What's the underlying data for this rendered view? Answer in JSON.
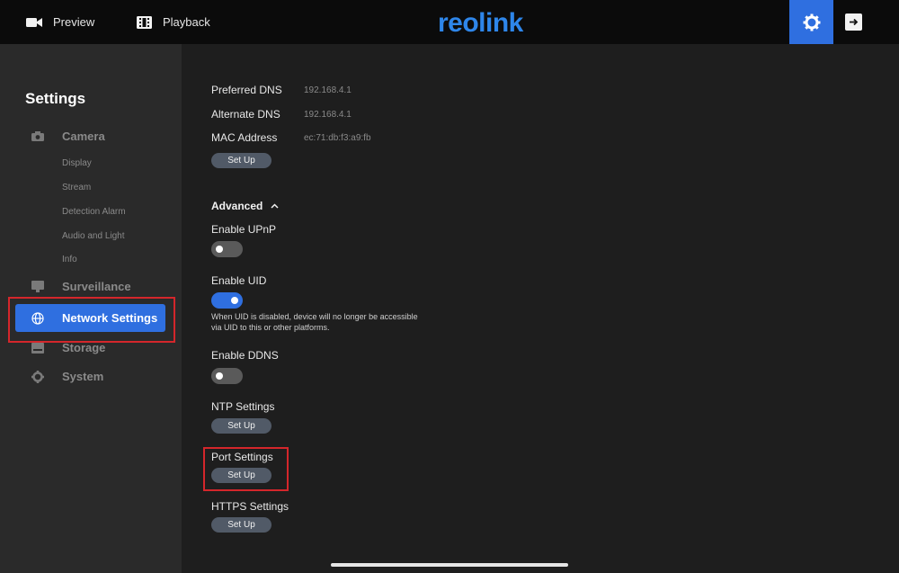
{
  "topbar": {
    "preview_label": "Preview",
    "playback_label": "Playback",
    "logo_text": "reolink",
    "accent_color": "#2f6fe0"
  },
  "sidebar": {
    "title": "Settings",
    "camera": {
      "label": "Camera",
      "items": [
        "Display",
        "Stream",
        "Detection Alarm",
        "Audio and Light",
        "Info"
      ]
    },
    "surveillance_label": "Surveillance",
    "network_label": "Network Settings",
    "storage_label": "Storage",
    "system_label": "System"
  },
  "main": {
    "preferred_dns": {
      "label": "Preferred DNS",
      "value": "192.168.4.1"
    },
    "alternate_dns": {
      "label": "Alternate DNS",
      "value": "192.168.4.1"
    },
    "mac_address": {
      "label": "MAC Address",
      "value": "ec:71:db:f3:a9:fb"
    },
    "setup_label": "Set Up",
    "advanced_label": "Advanced",
    "upnp": {
      "label": "Enable UPnP",
      "enabled": false
    },
    "uid": {
      "label": "Enable UID",
      "enabled": true,
      "note": "When UID is disabled, device will no longer be accessible via UID to this or other platforms."
    },
    "ddns": {
      "label": "Enable DDNS",
      "enabled": false
    },
    "ntp_label": "NTP Settings",
    "port_label": "Port Settings",
    "https_label": "HTTPS Settings"
  }
}
